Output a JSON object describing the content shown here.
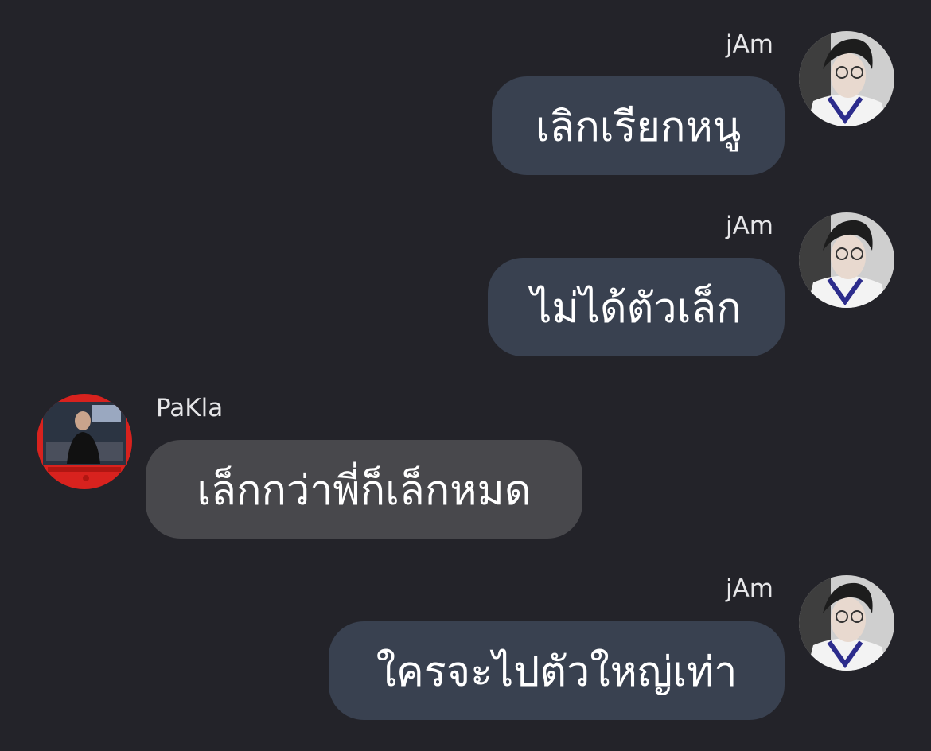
{
  "messages": [
    {
      "sender": "jAm",
      "direction": "outgoing",
      "text": "เลิกเรียกหนู",
      "avatar_icon": "user-avatar-icon"
    },
    {
      "sender": "jAm",
      "direction": "outgoing",
      "text": "ไม่ได้ตัวเล็ก",
      "avatar_icon": "user-avatar-icon"
    },
    {
      "sender": "PaKla",
      "direction": "incoming",
      "text": "เล็กกว่าพี่ก็เล็กหมด",
      "avatar_icon": "contact-avatar-icon"
    },
    {
      "sender": "jAm",
      "direction": "outgoing",
      "text": "ใครจะไปตัวใหญ่เท่า",
      "avatar_icon": "user-avatar-icon"
    }
  ],
  "colors": {
    "background": "#232329",
    "outgoing_bubble": "#394150",
    "incoming_bubble": "#48484c",
    "text": "#ffffff",
    "name_text": "#e6e6e8"
  }
}
